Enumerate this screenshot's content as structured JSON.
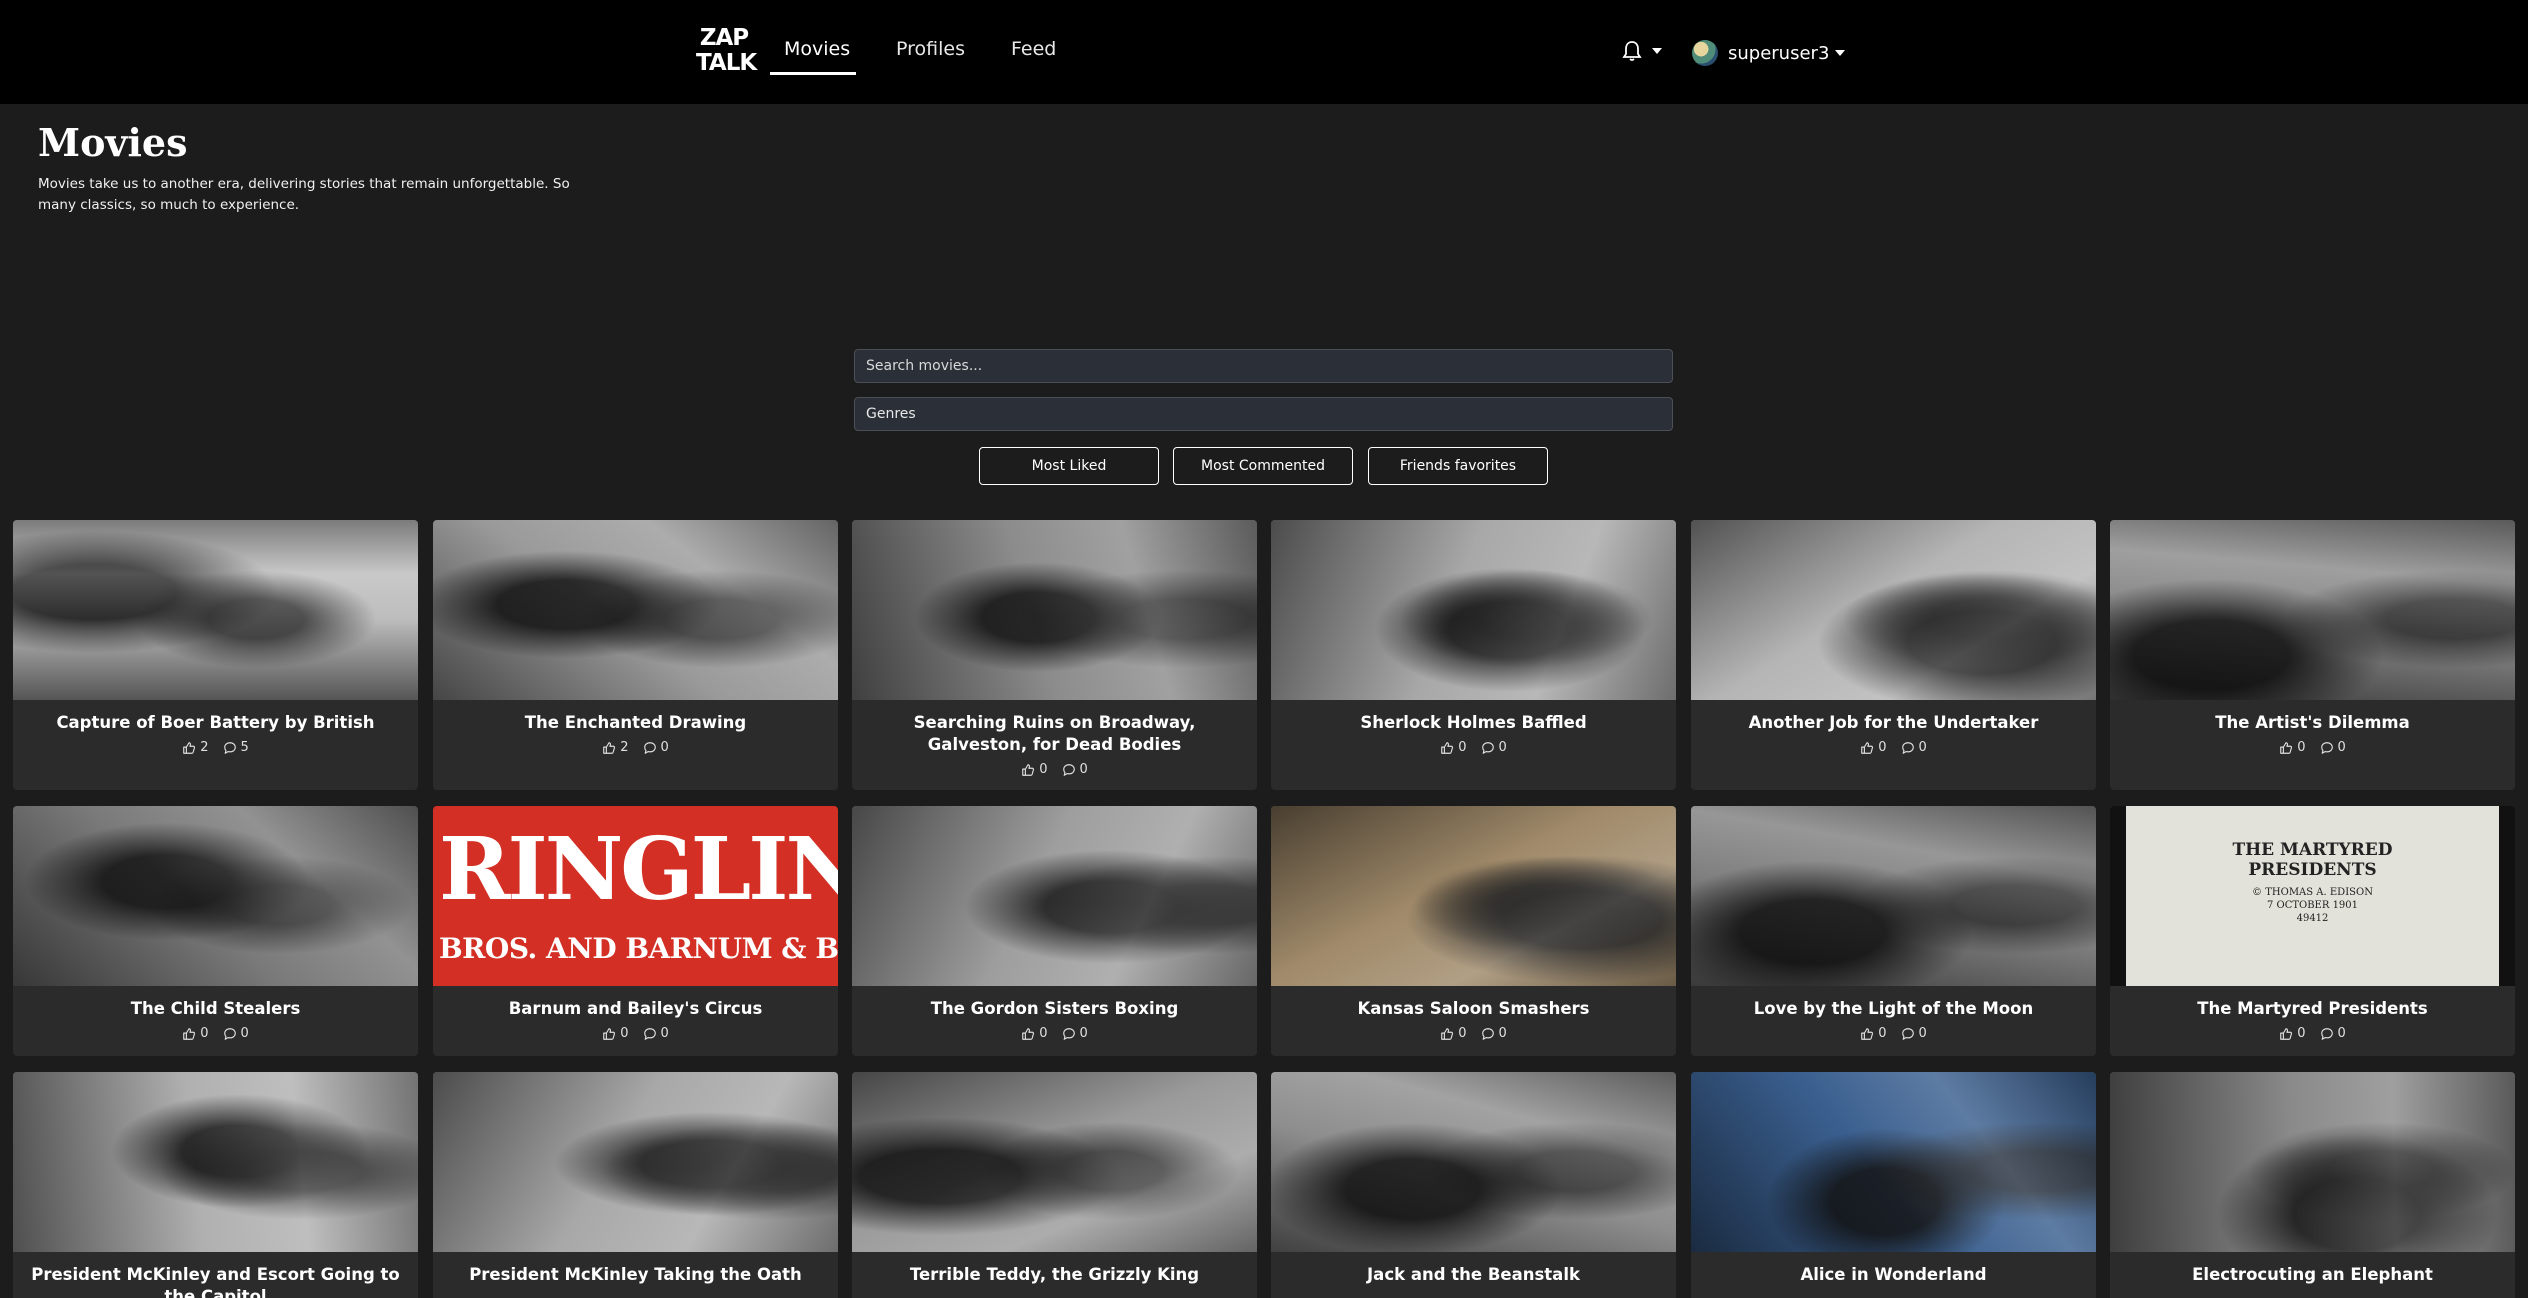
{
  "nav": {
    "logo_top": "ZAP",
    "logo_bottom": "TALK",
    "links": [
      "Movies",
      "Profiles",
      "Feed"
    ],
    "username": "superuser3"
  },
  "header": {
    "title": "Movies",
    "description": "Movies take us to another era, delivering stories that remain unforgettable. So many classics, so much to experience."
  },
  "search": {
    "placeholder": "Search movies...",
    "genres_label": "Genres"
  },
  "filters": [
    "Most Liked",
    "Most Commented",
    "Friends favorites"
  ],
  "movies": [
    {
      "title": "Capture of Boer Battery by British",
      "likes": "2",
      "comments": "5",
      "tone": "#bdbdbd"
    },
    {
      "title": "The Enchanted Drawing",
      "likes": "2",
      "comments": "0",
      "tone": "#9a9a9a"
    },
    {
      "title": "Searching Ruins on Broadway, Galveston, for Dead Bodies",
      "likes": "0",
      "comments": "0",
      "tone": "#8c8c8c"
    },
    {
      "title": "Sherlock Holmes Baffled",
      "likes": "0",
      "comments": "0",
      "tone": "#a8a8a8"
    },
    {
      "title": "Another Job for the Undertaker",
      "likes": "0",
      "comments": "0",
      "tone": "#b5b5b5"
    },
    {
      "title": "The Artist's Dilemma",
      "likes": "0",
      "comments": "0",
      "tone": "#8a8a8a"
    },
    {
      "title": "The Child Stealers",
      "likes": "0",
      "comments": "0",
      "tone": "#7a7a7a"
    },
    {
      "title": "Barnum and Bailey's Circus",
      "likes": "0",
      "comments": "0",
      "tone": "#d32f24",
      "poster_line1": "RINGLING",
      "poster_line2": "BROS. AND BARNUM & BAILEY"
    },
    {
      "title": "The Gordon Sisters Boxing",
      "likes": "0",
      "comments": "0",
      "tone": "#9e9e9e"
    },
    {
      "title": "Kansas Saloon Smashers",
      "likes": "0",
      "comments": "0",
      "tone": "#a08a6a"
    },
    {
      "title": "Love by the Light of the Moon",
      "likes": "0",
      "comments": "0",
      "tone": "#808080"
    },
    {
      "title": "The Martyred Presidents",
      "likes": "0",
      "comments": "0",
      "tone": "#dcdcd4",
      "poster_line1": "THE MARTYRED",
      "poster_line2": "PRESIDENTS",
      "poster_line3": "© THOMAS A. EDISON",
      "poster_line4": "7 OCTOBER 1901",
      "poster_line5": "49412"
    },
    {
      "title": "President McKinley and Escort Going to the Capitol",
      "likes": "",
      "comments": "",
      "tone": "#b0b0b0"
    },
    {
      "title": "President McKinley Taking the Oath",
      "likes": "",
      "comments": "",
      "tone": "#a8a8a8"
    },
    {
      "title": "Terrible Teddy, the Grizzly King",
      "likes": "",
      "comments": "",
      "tone": "#9a9a9a"
    },
    {
      "title": "Jack and the Beanstalk",
      "likes": "",
      "comments": "",
      "tone": "#8e8e8e"
    },
    {
      "title": "Alice in Wonderland",
      "likes": "",
      "comments": "",
      "tone": "#3a5f8f"
    },
    {
      "title": "Electrocuting an Elephant",
      "likes": "",
      "comments": "",
      "tone": "#8a8a8a"
    }
  ]
}
